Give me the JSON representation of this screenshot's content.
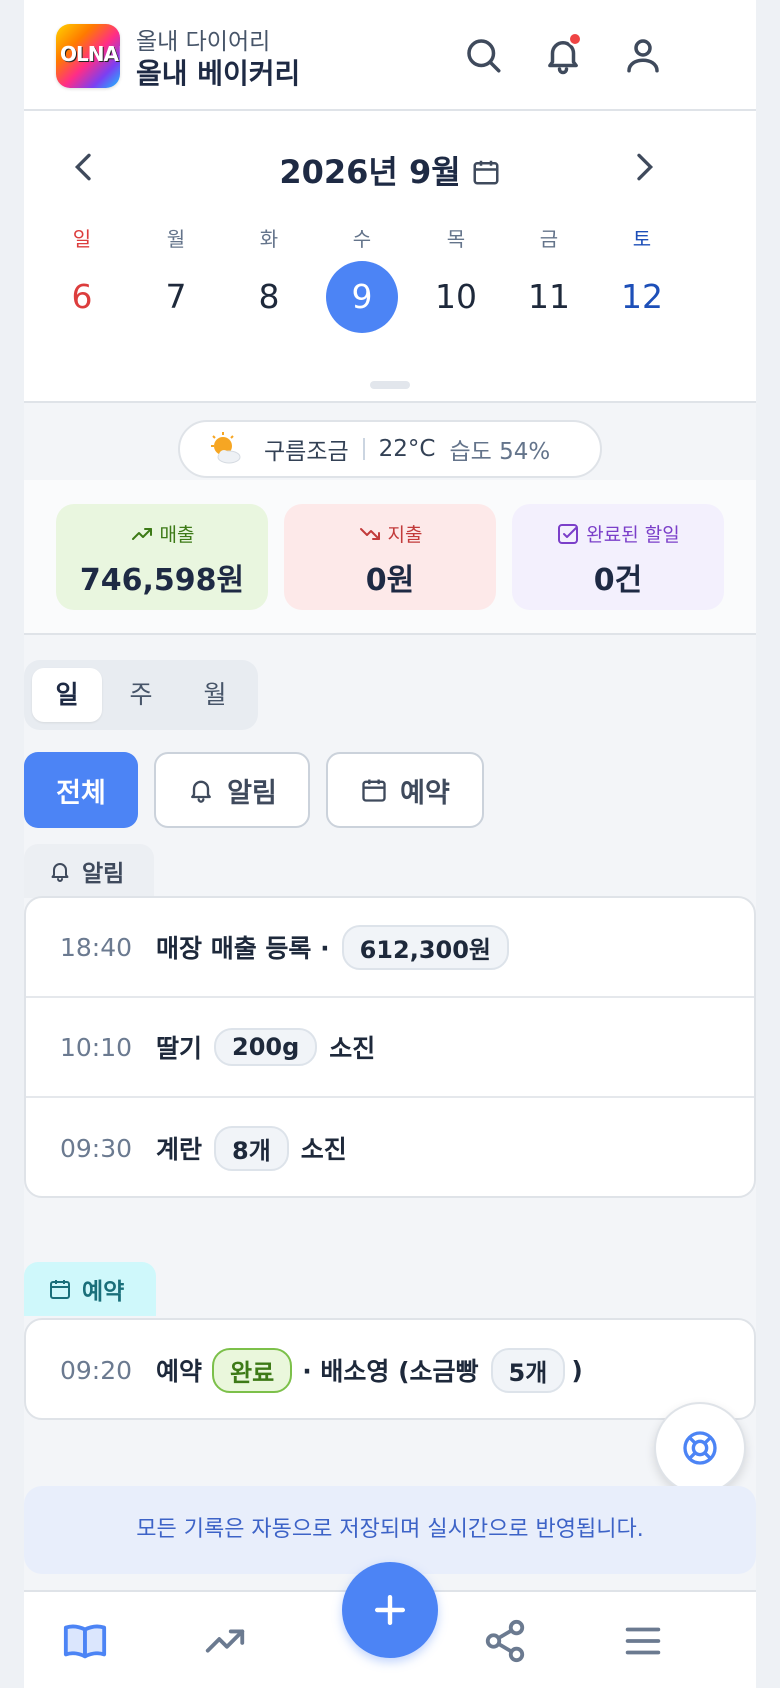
{
  "header": {
    "brand_sub": "올내 다이어리",
    "brand_title": "올내 베이커리",
    "logo_text": "OLNAE",
    "has_notification": true
  },
  "calendar": {
    "title": "2026년 9월",
    "weekdays": [
      "일",
      "월",
      "화",
      "수",
      "목",
      "금",
      "토"
    ],
    "days": [
      "6",
      "7",
      "8",
      "9",
      "10",
      "11",
      "12"
    ],
    "selected_index": 3
  },
  "weather": {
    "condition": "구름조금",
    "temperature": "22°C",
    "humidity": "습도 54%",
    "icon": "partly-cloudy-icon"
  },
  "summary": {
    "sales_label": "매출",
    "sales_value": "746,598원",
    "expense_label": "지출",
    "expense_value": "0원",
    "todo_label": "완료된 할일",
    "todo_value": "0건"
  },
  "period": {
    "options": [
      "일",
      "주",
      "월"
    ],
    "active_index": 0
  },
  "filters": {
    "all": "전체",
    "alerts": "알림",
    "reservations": "예약",
    "active": "all"
  },
  "alerts": {
    "title": "알림",
    "items": [
      {
        "time": "18:40",
        "text": "매장 매출 등록 ·",
        "chip": "612,300원",
        "suffix": ""
      },
      {
        "time": "10:10",
        "text": "딸기",
        "chip": "200g",
        "suffix": "소진"
      },
      {
        "time": "09:30",
        "text": "계란",
        "chip": "8개",
        "suffix": "소진"
      }
    ]
  },
  "reservations": {
    "title": "예약",
    "items": [
      {
        "time": "09:20",
        "text": "예약",
        "status": "완료",
        "detail": "· 배소영 (소금빵",
        "chip": "5개",
        "close": ")"
      }
    ]
  },
  "footer": {
    "info": "모든 기록은 자동으로 저장되며 실시간으로 반영됩니다."
  },
  "colors": {
    "accent": "#4c84f5",
    "sunday": "#dc3d3d",
    "saturday": "#1d4fb8",
    "sales": "#3d7a17",
    "expense": "#c23b3b",
    "todo": "#7b3fc9"
  }
}
